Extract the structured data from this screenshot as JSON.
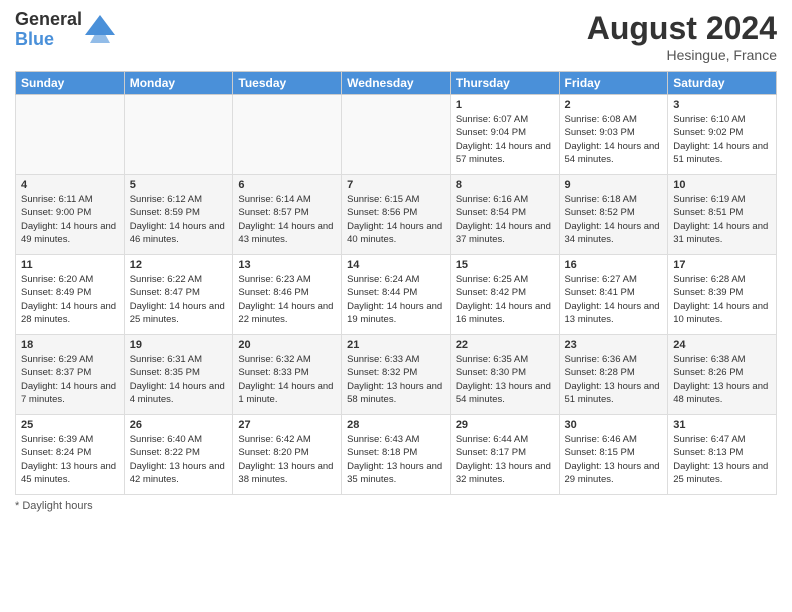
{
  "logo": {
    "general": "General",
    "blue": "Blue"
  },
  "title": "August 2024",
  "location": "Hesingue, France",
  "days_of_week": [
    "Sunday",
    "Monday",
    "Tuesday",
    "Wednesday",
    "Thursday",
    "Friday",
    "Saturday"
  ],
  "footer": "Daylight hours",
  "weeks": [
    [
      {
        "day": "",
        "info": ""
      },
      {
        "day": "",
        "info": ""
      },
      {
        "day": "",
        "info": ""
      },
      {
        "day": "",
        "info": ""
      },
      {
        "day": "1",
        "info": "Sunrise: 6:07 AM\nSunset: 9:04 PM\nDaylight: 14 hours\nand 57 minutes."
      },
      {
        "day": "2",
        "info": "Sunrise: 6:08 AM\nSunset: 9:03 PM\nDaylight: 14 hours\nand 54 minutes."
      },
      {
        "day": "3",
        "info": "Sunrise: 6:10 AM\nSunset: 9:02 PM\nDaylight: 14 hours\nand 51 minutes."
      }
    ],
    [
      {
        "day": "4",
        "info": "Sunrise: 6:11 AM\nSunset: 9:00 PM\nDaylight: 14 hours\nand 49 minutes."
      },
      {
        "day": "5",
        "info": "Sunrise: 6:12 AM\nSunset: 8:59 PM\nDaylight: 14 hours\nand 46 minutes."
      },
      {
        "day": "6",
        "info": "Sunrise: 6:14 AM\nSunset: 8:57 PM\nDaylight: 14 hours\nand 43 minutes."
      },
      {
        "day": "7",
        "info": "Sunrise: 6:15 AM\nSunset: 8:56 PM\nDaylight: 14 hours\nand 40 minutes."
      },
      {
        "day": "8",
        "info": "Sunrise: 6:16 AM\nSunset: 8:54 PM\nDaylight: 14 hours\nand 37 minutes."
      },
      {
        "day": "9",
        "info": "Sunrise: 6:18 AM\nSunset: 8:52 PM\nDaylight: 14 hours\nand 34 minutes."
      },
      {
        "day": "10",
        "info": "Sunrise: 6:19 AM\nSunset: 8:51 PM\nDaylight: 14 hours\nand 31 minutes."
      }
    ],
    [
      {
        "day": "11",
        "info": "Sunrise: 6:20 AM\nSunset: 8:49 PM\nDaylight: 14 hours\nand 28 minutes."
      },
      {
        "day": "12",
        "info": "Sunrise: 6:22 AM\nSunset: 8:47 PM\nDaylight: 14 hours\nand 25 minutes."
      },
      {
        "day": "13",
        "info": "Sunrise: 6:23 AM\nSunset: 8:46 PM\nDaylight: 14 hours\nand 22 minutes."
      },
      {
        "day": "14",
        "info": "Sunrise: 6:24 AM\nSunset: 8:44 PM\nDaylight: 14 hours\nand 19 minutes."
      },
      {
        "day": "15",
        "info": "Sunrise: 6:25 AM\nSunset: 8:42 PM\nDaylight: 14 hours\nand 16 minutes."
      },
      {
        "day": "16",
        "info": "Sunrise: 6:27 AM\nSunset: 8:41 PM\nDaylight: 14 hours\nand 13 minutes."
      },
      {
        "day": "17",
        "info": "Sunrise: 6:28 AM\nSunset: 8:39 PM\nDaylight: 14 hours\nand 10 minutes."
      }
    ],
    [
      {
        "day": "18",
        "info": "Sunrise: 6:29 AM\nSunset: 8:37 PM\nDaylight: 14 hours\nand 7 minutes."
      },
      {
        "day": "19",
        "info": "Sunrise: 6:31 AM\nSunset: 8:35 PM\nDaylight: 14 hours\nand 4 minutes."
      },
      {
        "day": "20",
        "info": "Sunrise: 6:32 AM\nSunset: 8:33 PM\nDaylight: 14 hours\nand 1 minute."
      },
      {
        "day": "21",
        "info": "Sunrise: 6:33 AM\nSunset: 8:32 PM\nDaylight: 13 hours\nand 58 minutes."
      },
      {
        "day": "22",
        "info": "Sunrise: 6:35 AM\nSunset: 8:30 PM\nDaylight: 13 hours\nand 54 minutes."
      },
      {
        "day": "23",
        "info": "Sunrise: 6:36 AM\nSunset: 8:28 PM\nDaylight: 13 hours\nand 51 minutes."
      },
      {
        "day": "24",
        "info": "Sunrise: 6:38 AM\nSunset: 8:26 PM\nDaylight: 13 hours\nand 48 minutes."
      }
    ],
    [
      {
        "day": "25",
        "info": "Sunrise: 6:39 AM\nSunset: 8:24 PM\nDaylight: 13 hours\nand 45 minutes."
      },
      {
        "day": "26",
        "info": "Sunrise: 6:40 AM\nSunset: 8:22 PM\nDaylight: 13 hours\nand 42 minutes."
      },
      {
        "day": "27",
        "info": "Sunrise: 6:42 AM\nSunset: 8:20 PM\nDaylight: 13 hours\nand 38 minutes."
      },
      {
        "day": "28",
        "info": "Sunrise: 6:43 AM\nSunset: 8:18 PM\nDaylight: 13 hours\nand 35 minutes."
      },
      {
        "day": "29",
        "info": "Sunrise: 6:44 AM\nSunset: 8:17 PM\nDaylight: 13 hours\nand 32 minutes."
      },
      {
        "day": "30",
        "info": "Sunrise: 6:46 AM\nSunset: 8:15 PM\nDaylight: 13 hours\nand 29 minutes."
      },
      {
        "day": "31",
        "info": "Sunrise: 6:47 AM\nSunset: 8:13 PM\nDaylight: 13 hours\nand 25 minutes."
      }
    ]
  ]
}
